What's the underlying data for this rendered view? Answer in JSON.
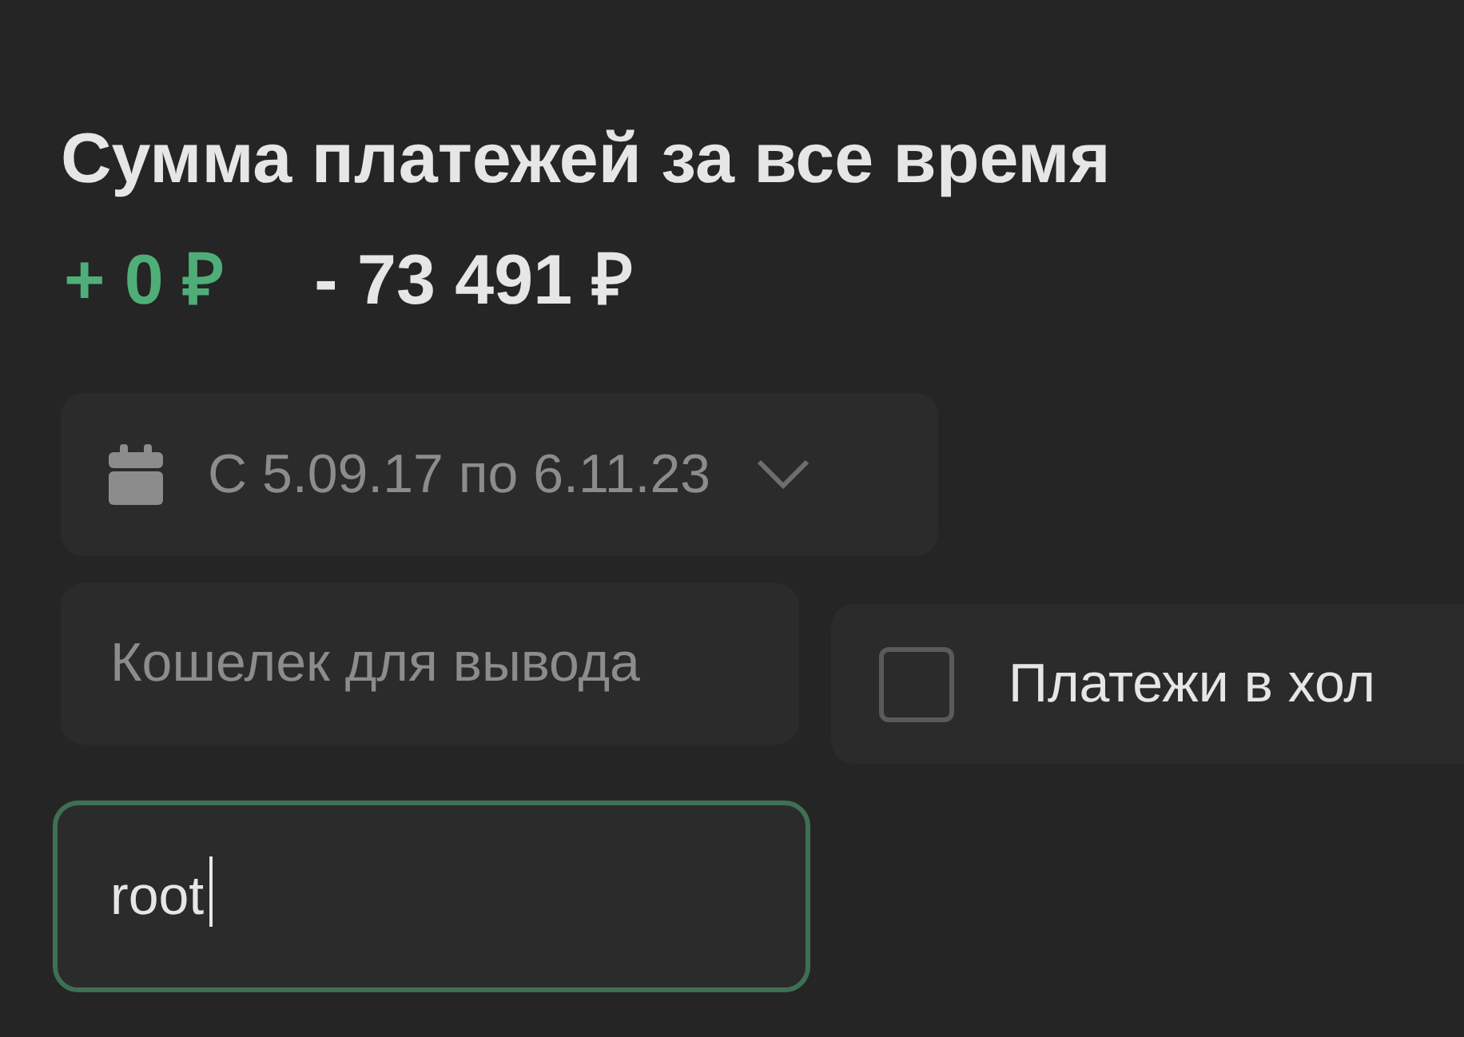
{
  "title": "Сумма платежей за все время",
  "totals": {
    "income": "+ 0 ₽",
    "expense": "- 73 491 ₽"
  },
  "date_range": {
    "label": "С 5.09.17 по 6.11.23"
  },
  "wallet_field": {
    "placeholder": "Кошелек для вывода"
  },
  "hold_filter": {
    "label": "Платежи в хол",
    "checked": false
  },
  "search_field": {
    "value": "root",
    "focused": true
  }
}
